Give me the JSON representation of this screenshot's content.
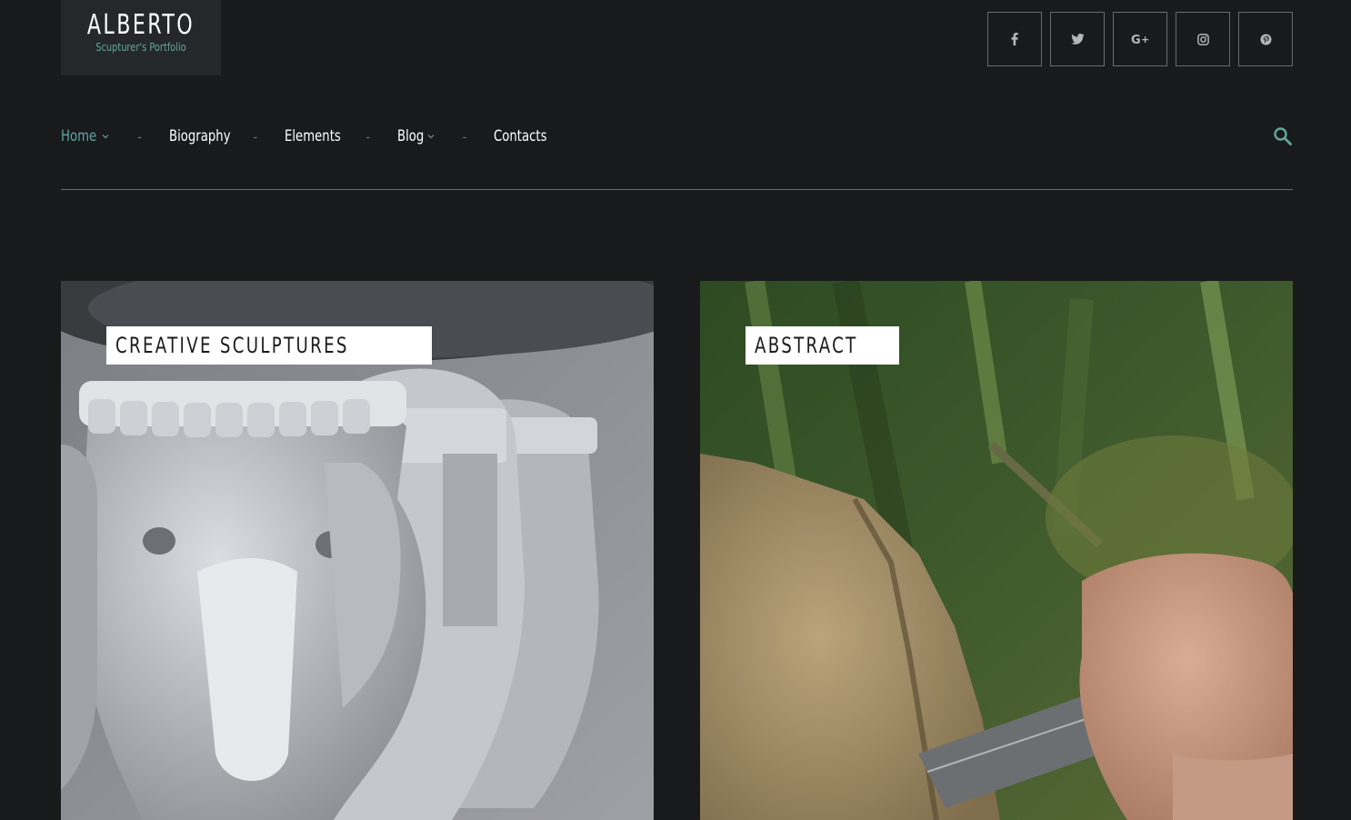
{
  "logo": {
    "title": "ALBERTO",
    "subtitle": "Scupturer's Portfolio"
  },
  "social": [
    {
      "name": "facebook-icon",
      "glyph": "f"
    },
    {
      "name": "twitter-icon",
      "glyph": ""
    },
    {
      "name": "google-plus-icon",
      "glyph": "G+"
    },
    {
      "name": "instagram-icon",
      "glyph": ""
    },
    {
      "name": "pinterest-icon",
      "glyph": ""
    }
  ],
  "nav": {
    "items": [
      {
        "label": "Home",
        "active": true,
        "has_dropdown": true
      },
      {
        "label": "Biography",
        "active": false,
        "has_dropdown": false
      },
      {
        "label": "Elements",
        "active": false,
        "has_dropdown": false
      },
      {
        "label": "Blog",
        "active": false,
        "has_dropdown": true
      },
      {
        "label": "Contacts",
        "active": false,
        "has_dropdown": false
      }
    ],
    "separator": "-"
  },
  "cards": [
    {
      "label": "CREATIVE SCULPTURES",
      "image": "elephant-sculpture"
    },
    {
      "label": "ABSTRACT",
      "image": "stone-carving"
    }
  ],
  "colors": {
    "background": "#191a1c",
    "accent": "#5fa89e",
    "logo_bg": "#26272a"
  }
}
